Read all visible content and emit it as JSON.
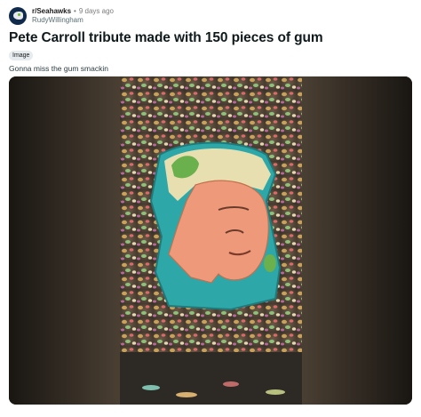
{
  "post": {
    "subreddit": "r/Seahawks",
    "separator": "•",
    "age": "9 days ago",
    "author": "RudyWillingham",
    "title": "Pete Carroll tribute made with 150 pieces of gum",
    "flair": "Image",
    "body": "Gonna miss the gum smackin"
  },
  "media": {
    "icon": "gum-wall-portrait-image"
  },
  "colors": {
    "background": "#ffffff",
    "avatar": "#0f2a4a",
    "flair_bg": "#e5ebee",
    "meta_muted": "#7c7c7c"
  }
}
